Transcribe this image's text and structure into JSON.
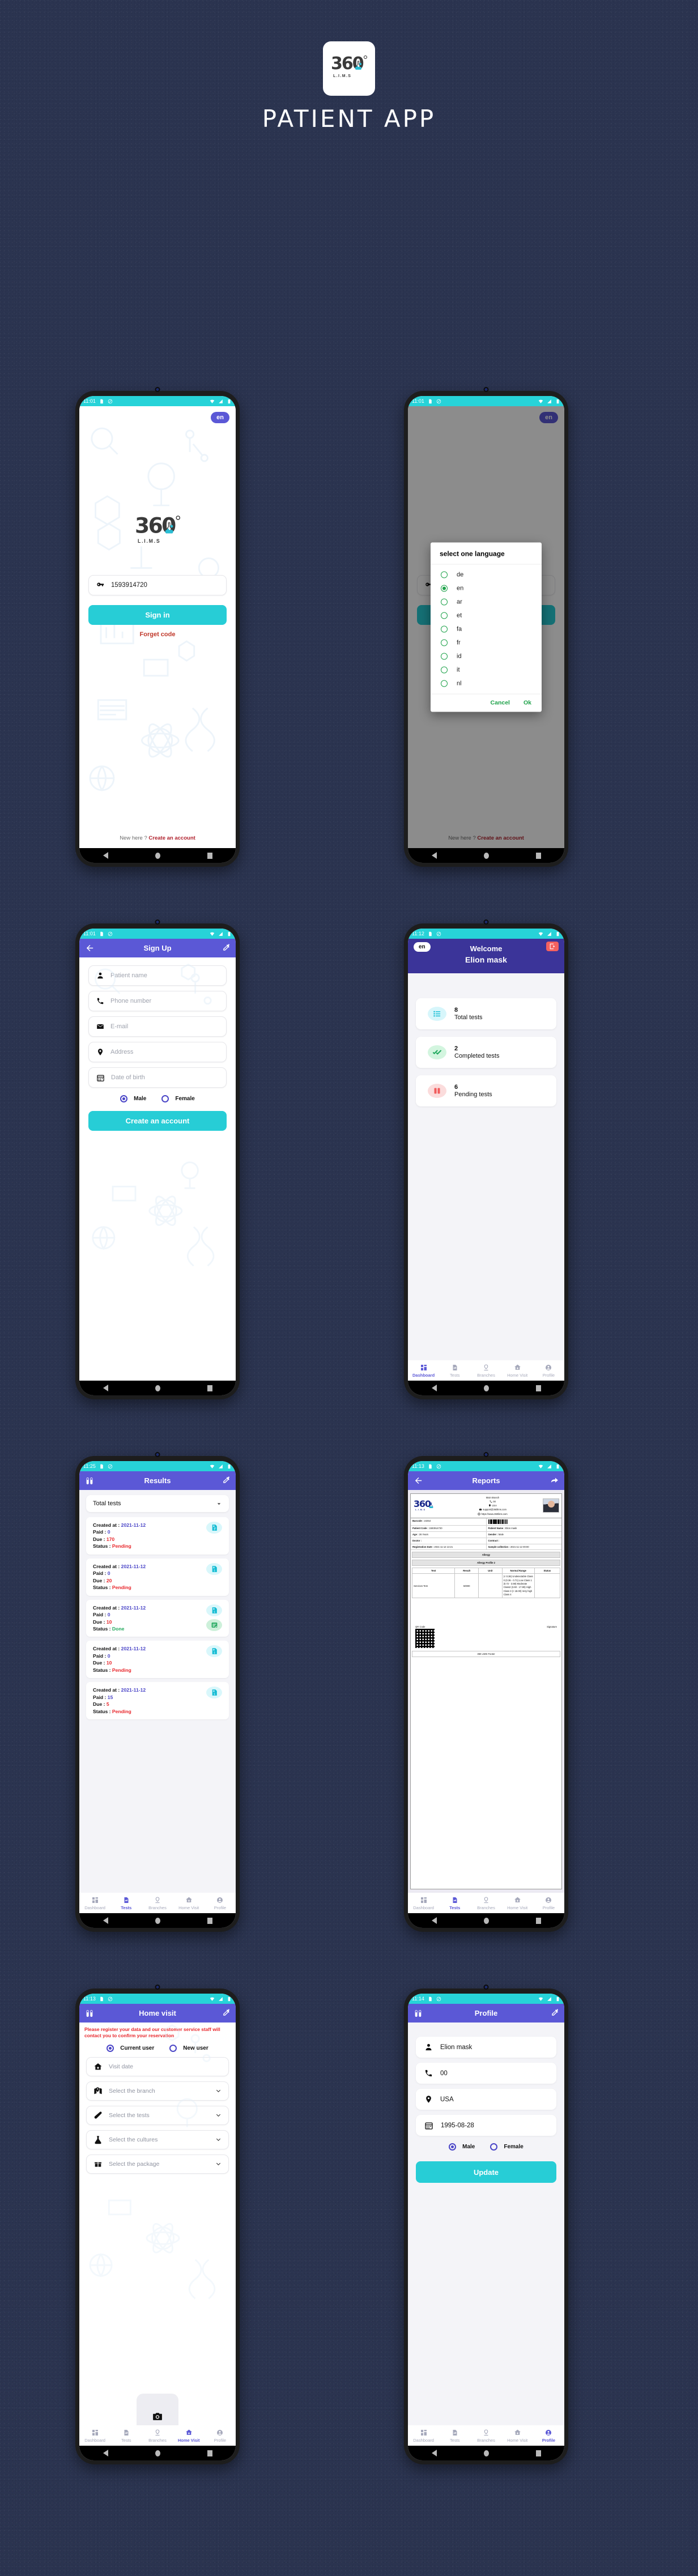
{
  "page": {
    "title": "PATIENT APP",
    "brand": {
      "name": "360",
      "sub": "L.I.M.S",
      "degree": "°"
    },
    "colors": {
      "background": "#2b3450",
      "accent_teal": "#27cdd6",
      "accent_purple": "#5b58d6",
      "danger": "#e8262b",
      "success": "#20a85b"
    }
  },
  "screens": {
    "login": {
      "status_time": "11:01",
      "lang_badge": "en",
      "code_value": "1593914720",
      "signin_label": "Sign in",
      "forget_label": "Forget code",
      "footer_prefix": "New here ? ",
      "footer_link": "Create an account"
    },
    "language_dialog": {
      "status_time": "11:01",
      "lang_badge": "en",
      "title": "select one language",
      "options": [
        "de",
        "en",
        "ar",
        "et",
        "fa",
        "fr",
        "id",
        "it",
        "nl"
      ],
      "selected": "en",
      "cancel_label": "Cancel",
      "ok_label": "Ok",
      "footer_prefix": "New here ? ",
      "footer_link": "Create an account"
    },
    "signup": {
      "status_time": "11:01",
      "title": "Sign Up",
      "fields": [
        {
          "icon": "person-icon",
          "placeholder": "Patient name"
        },
        {
          "icon": "phone-icon",
          "placeholder": "Phone number"
        },
        {
          "icon": "mail-icon",
          "placeholder": "E-mail"
        },
        {
          "icon": "location-pin-icon",
          "placeholder": "Address"
        },
        {
          "icon": "calendar-icon",
          "placeholder": "Date of birth"
        }
      ],
      "gender": {
        "male": "Male",
        "female": "Female",
        "selected": "Male"
      },
      "submit_label": "Create an account"
    },
    "dashboard": {
      "status_time": "11:12",
      "lang_badge": "en",
      "welcome": "Welcome",
      "user_name": "Elion mask",
      "stats": [
        {
          "icon": "list-icon",
          "value": "8",
          "label": "Total tests"
        },
        {
          "icon": "double-check-icon",
          "value": "2",
          "label": "Completed tests"
        },
        {
          "icon": "pause-icon",
          "value": "6",
          "label": "Pending tests"
        }
      ],
      "active_tab": "Dashboard"
    },
    "results": {
      "status_time": "11:25",
      "title": "Results",
      "filter_value": "Total tests",
      "labels": {
        "created": "Created at  : ",
        "paid": "Paid : ",
        "due": "Due : ",
        "status": "Status : "
      },
      "rows": [
        {
          "created": "2021-11-12",
          "paid": "0",
          "due": "170",
          "status": "Pending",
          "has_report": false
        },
        {
          "created": "2021-11-12",
          "paid": "0",
          "due": "20",
          "status": "Pending",
          "has_report": false
        },
        {
          "created": "2021-11-12",
          "paid": "0",
          "due": "10",
          "status": "Done",
          "has_report": true
        },
        {
          "created": "2021-11-12",
          "paid": "0",
          "due": "10",
          "status": "Pending",
          "has_report": false
        },
        {
          "created": "2021-11-12",
          "paid": "15",
          "due": "5",
          "status": "Pending",
          "has_report": false
        }
      ],
      "active_tab": "Tests"
    },
    "reports": {
      "status_time": "11:13",
      "title": "Reports",
      "header": {
        "branch": "Main Branch",
        "phone": "00",
        "country": "USA",
        "email": "support@360lims.com",
        "website": "https://www.360lims.com"
      },
      "info_rows": [
        [
          {
            "label": "Barcode :",
            "value": "24454"
          },
          {
            "label": "",
            "value": "",
            "barcode": true
          }
        ],
        [
          {
            "label": "Patient Code :",
            "value": "1593914720"
          },
          {
            "label": "Patient Name :",
            "value": "Elion mask"
          }
        ],
        [
          {
            "label": "Age :",
            "value": "26 Years"
          },
          {
            "label": "Gender :",
            "value": "Male"
          }
        ],
        [
          {
            "label": "Doctor :",
            "value": ""
          },
          {
            "label": "Contract :",
            "value": ""
          }
        ],
        [
          {
            "label": "Registration Date :",
            "value": "2021-11-12 13:21"
          },
          {
            "label": "Sample collection :",
            "value": "2021-11-12 00:00"
          }
        ]
      ],
      "band1": "Allergy",
      "band2": "Allergy Profile 2",
      "table_headers": [
        "Test",
        "Result",
        "Unit",
        "Normal Range",
        "Status"
      ],
      "table_row": {
        "test": "Services Test",
        "result": "50000",
        "unit": "",
        "normal_range": "(< 0.36) Undetectable Class 0 (0.36 - 0.71) Low Class 1 (0.72 - 3.59) Moderate Class2 (3.60 - 17.99) High Class 3 (> 18.00) Very high Class 4",
        "status": ""
      },
      "qr_label": "QR Code",
      "signature_label": "Signature",
      "footer": "360 LIMS Footer",
      "active_tab": "Tests"
    },
    "home_visit": {
      "status_time": "11:13",
      "title": "Home visit",
      "warning": "Please register your data  and our customer service staff will contact  you to confirm your reservation",
      "user_type": {
        "current": "Current user",
        "new": "New user",
        "selected": "Current user"
      },
      "fields": [
        {
          "icon": "home-health-icon",
          "placeholder": "Visit date",
          "chevron": false
        },
        {
          "icon": "map-pin-icon",
          "placeholder": "Select the branch",
          "chevron": true
        },
        {
          "icon": "test-tube-icon",
          "placeholder": "Select the tests",
          "chevron": true
        },
        {
          "icon": "flask-icon",
          "placeholder": "Select the cultures",
          "chevron": true
        },
        {
          "icon": "package-icon",
          "placeholder": "Select the package",
          "chevron": true
        }
      ],
      "camera_icon": "camera-icon",
      "active_tab": "Home Visit"
    },
    "profile": {
      "status_time": "11:14",
      "title": "Profile",
      "fields": [
        {
          "icon": "person-icon",
          "value": "Elion mask"
        },
        {
          "icon": "phone-icon",
          "value": "00"
        },
        {
          "icon": "location-pin-icon",
          "value": "USA"
        },
        {
          "icon": "calendar-icon",
          "value": "1995-08-28"
        }
      ],
      "gender": {
        "male": "Male",
        "female": "Female",
        "selected": "Male"
      },
      "update_label": "Update",
      "active_tab": "Profile"
    }
  },
  "tabbar": {
    "items": [
      {
        "icon": "dashboard-icon",
        "label": "Dashboard"
      },
      {
        "icon": "tests-icon",
        "label": "Tests"
      },
      {
        "icon": "branches-icon",
        "label": "Branches"
      },
      {
        "icon": "home-visit-icon",
        "label": "Home Visit"
      },
      {
        "icon": "profile-icon",
        "label": "Profile"
      }
    ]
  }
}
